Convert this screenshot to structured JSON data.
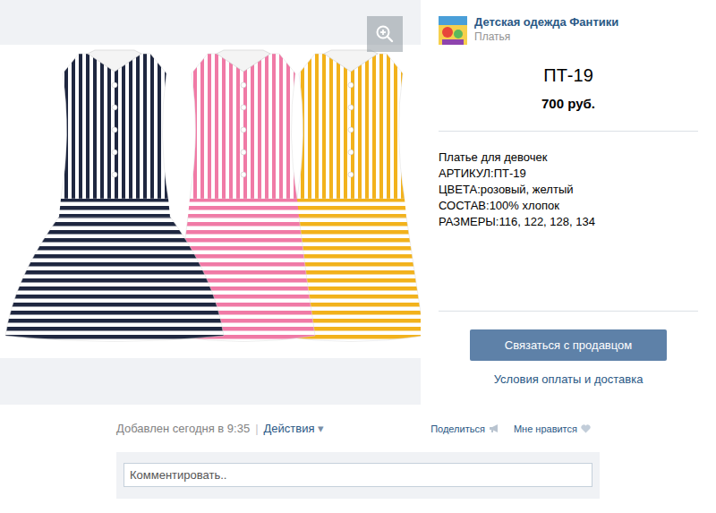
{
  "shop": {
    "name": "Детская одежда Фантики",
    "category": "Платья"
  },
  "product": {
    "title": "ПТ-19",
    "price": "700 руб.",
    "description": [
      "Платье для девочек",
      "АРТИКУЛ:ПТ-19",
      "ЦВЕТА:розовый, желтый",
      "СОСТАВ:100% хлопок",
      "РАЗМЕРЫ:116, 122, 128, 134"
    ]
  },
  "contact_button": "Связаться с продавцом",
  "terms_link": "Условия оплаты и доставка",
  "footer": {
    "added": "Добавлен сегодня в 9:35",
    "separator": "|",
    "actions": "Действия",
    "actions_arrow": "▾",
    "share": "Поделиться",
    "like": "Мне нравится"
  },
  "comment": {
    "placeholder": "Комментировать.."
  }
}
